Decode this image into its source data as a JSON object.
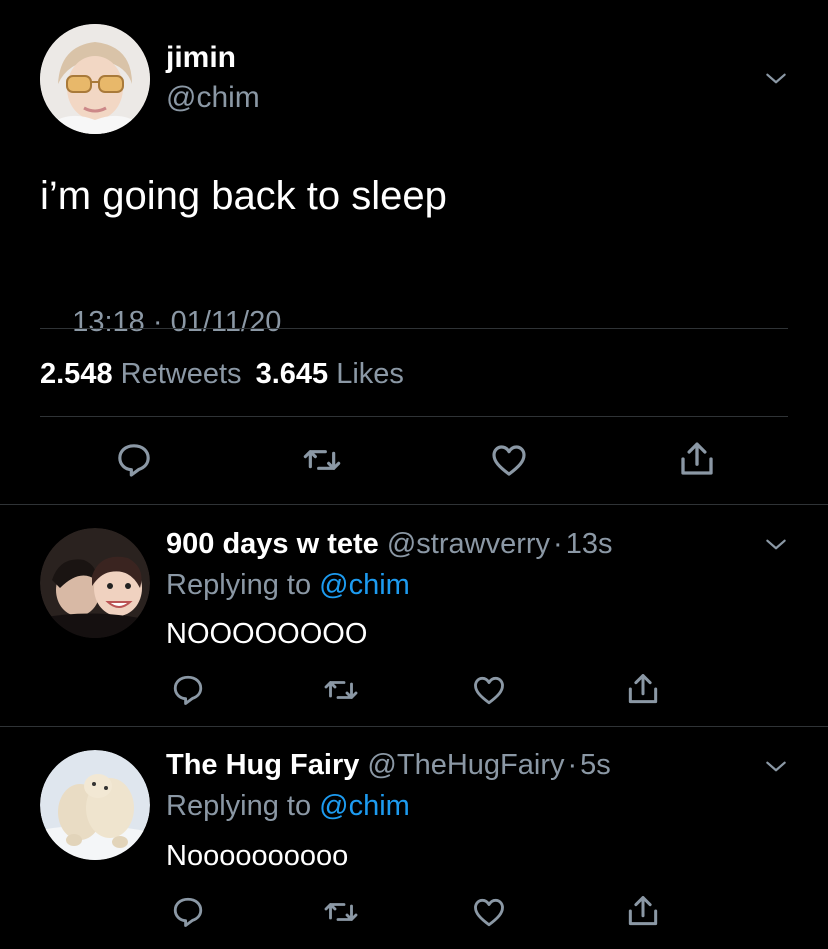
{
  "main_tweet": {
    "display_name": "jimin",
    "handle": "@chim",
    "text": "i’m going back to sleep",
    "time": "13:18",
    "separator": " · ",
    "date": "01/11/20",
    "retweet_count": "2.548",
    "retweet_label": "Retweets",
    "like_count": "3.645",
    "like_label": "Likes"
  },
  "replies": [
    {
      "display_name": "900 days w tete",
      "handle": "@strawverry",
      "separator": "·",
      "age": "13s",
      "replying_prefix": "Replying to",
      "replying_handle": "@chim",
      "text": "NOOOOOOOO"
    },
    {
      "display_name": "The Hug Fairy",
      "handle": "@TheHugFairy",
      "separator": "·",
      "age": "5s",
      "replying_prefix": "Replying to",
      "replying_handle": "@chim",
      "text": "Noooooooooo"
    }
  ],
  "icons": {
    "reply": "reply-icon",
    "retweet": "retweet-icon",
    "like": "heart-icon",
    "share": "share-icon",
    "menu": "chevron-down-icon"
  },
  "colors": {
    "background": "#000000",
    "text": "#ffffff",
    "muted": "#8b98a5",
    "link": "#1d9bf0",
    "divider": "#2f3336"
  }
}
